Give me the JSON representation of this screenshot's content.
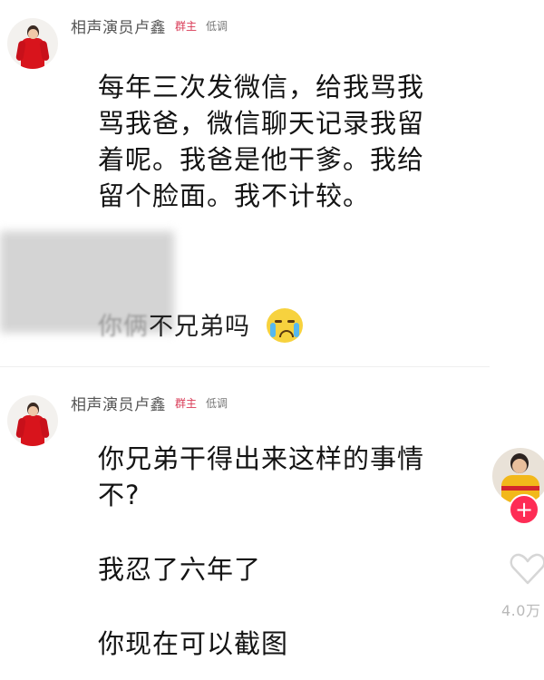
{
  "comments": [
    {
      "author": "相声演员卢鑫",
      "badge": "群主",
      "level": "低调",
      "lines": [
        "每年三次发微信，给我骂我",
        "骂我爸，微信聊天记录我留",
        "着呢。我爸是他干爹。我给",
        "留个脸面。我不计较。"
      ]
    },
    {
      "author": "相声演员卢鑫",
      "badge": "群主",
      "level": "低调",
      "lines": [
        "你兄弟干得出来这样的事情",
        "不?"
      ],
      "line2": "我忍了六年了",
      "line3": "你现在可以截图"
    }
  ],
  "quoted": {
    "prefix": "你俩",
    "text": "不兄弟吗"
  },
  "rail": {
    "follow_label": "+",
    "like_count": "4.0万"
  },
  "colors": {
    "badge": "#d93a56",
    "follow": "#fe2c55",
    "robe": "#d8141c"
  },
  "icons": [
    "avatar",
    "crying-emoji-icon",
    "plus-icon",
    "heart-icon"
  ]
}
